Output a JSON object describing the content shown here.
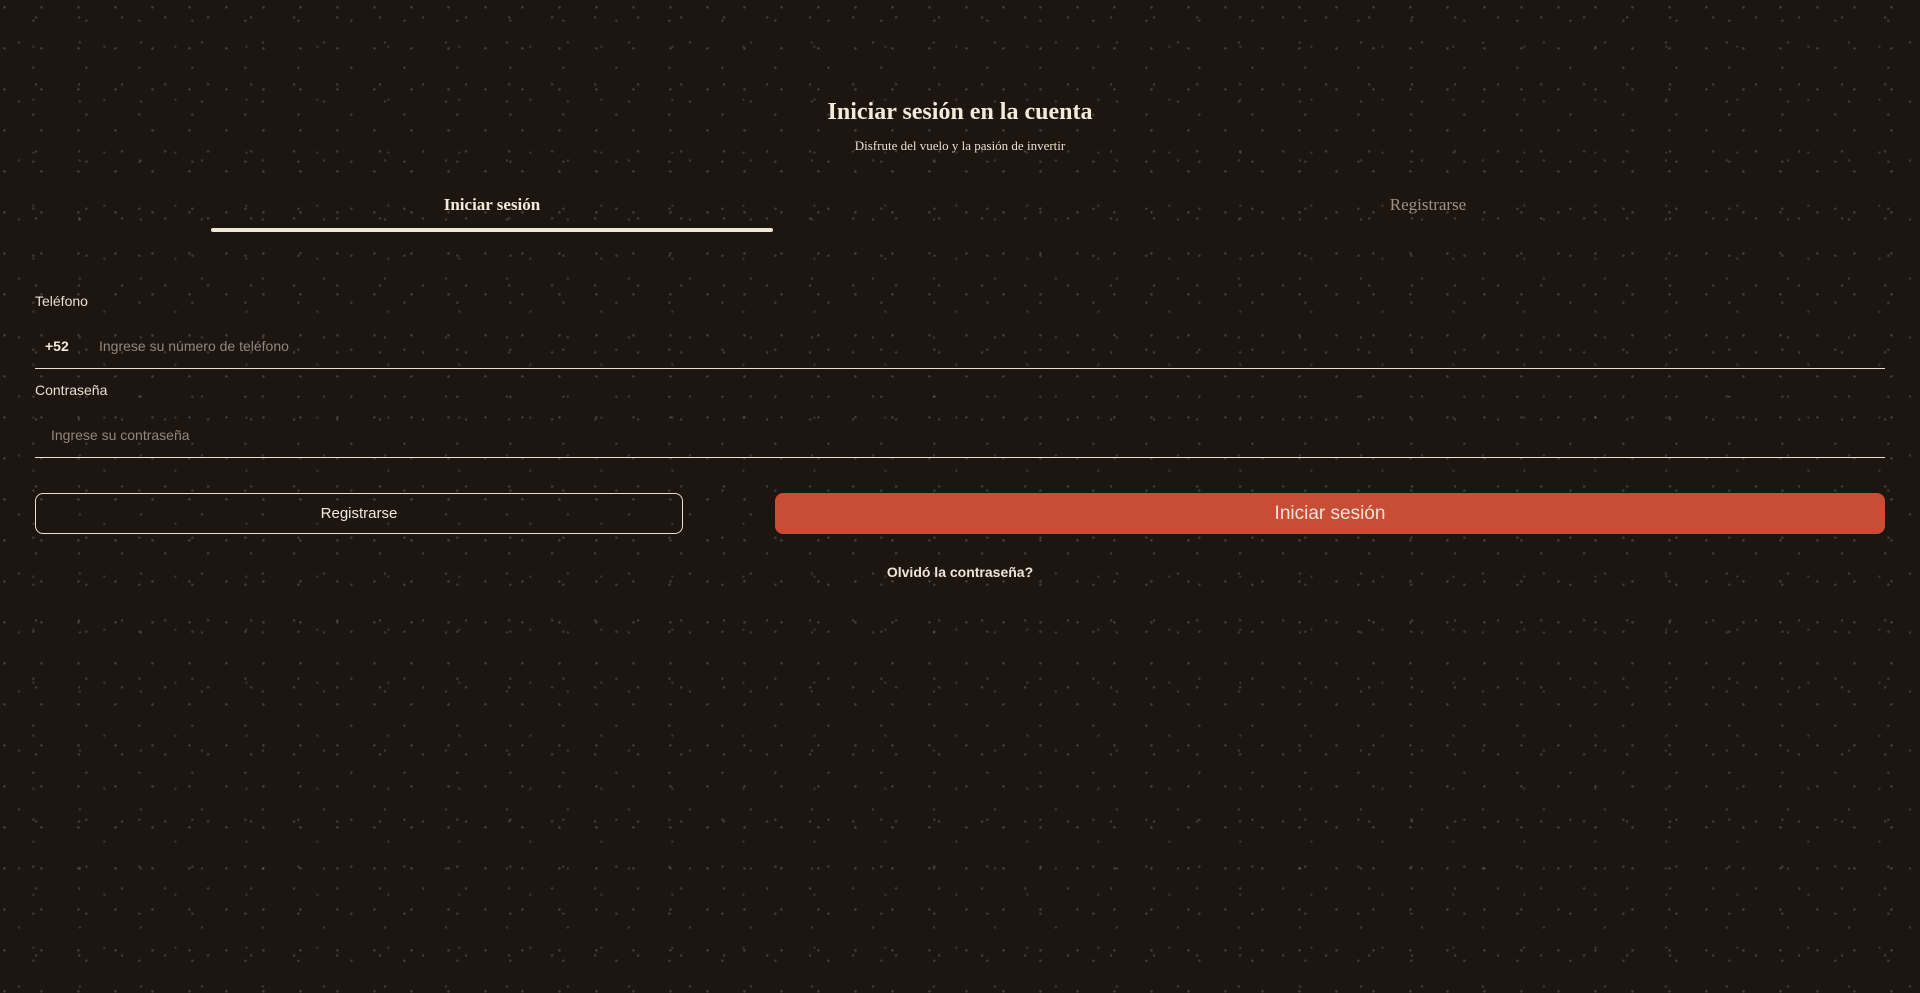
{
  "header": {
    "title": "Iniciar sesión en la cuenta",
    "subtitle": "Disfrute del vuelo y la pasión de invertir"
  },
  "tabs": [
    {
      "label": "Iniciar sesión",
      "active": true
    },
    {
      "label": "Registrarse",
      "active": false
    }
  ],
  "form": {
    "phone": {
      "label": "Teléfono",
      "prefix": "+52",
      "placeholder": "Ingrese su número de teléfono",
      "value": ""
    },
    "password": {
      "label": "Contraseña",
      "placeholder": "Ingrese su contraseña",
      "value": ""
    }
  },
  "actions": {
    "register_label": "Registrarse",
    "login_label": "Iniciar sesión",
    "forgot_label": "Olvidó la contraseña?"
  },
  "colors": {
    "background": "#1d1510",
    "accent": "#c94d35",
    "text": "#efe6d6",
    "muted": "#9c9289"
  }
}
